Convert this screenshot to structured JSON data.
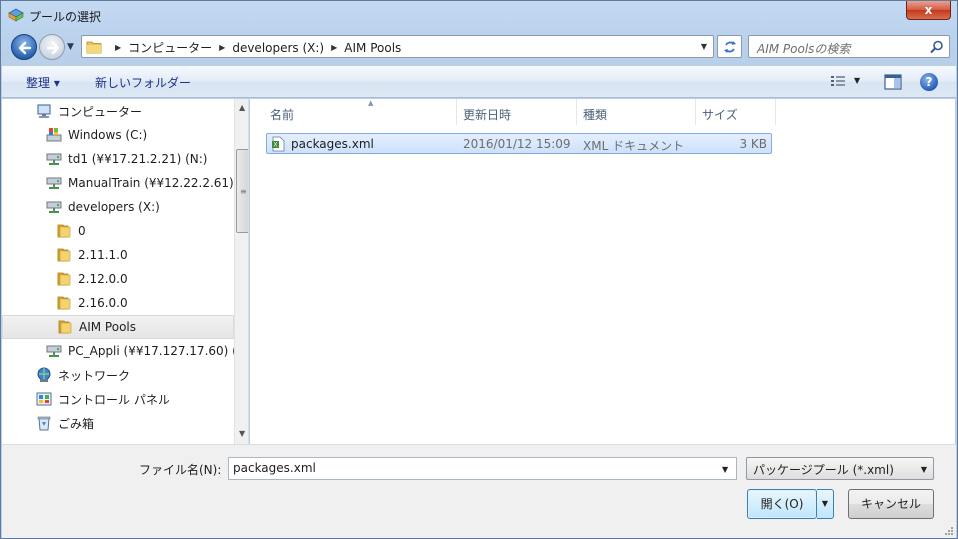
{
  "window": {
    "title": "プールの選択",
    "close_label": "x"
  },
  "address": {
    "crumbs": [
      "コンピューター",
      "developers (X:)",
      "AIM Pools"
    ]
  },
  "search": {
    "placeholder": "AIM Poolsの検索"
  },
  "toolbar": {
    "organize": "整理 ▾",
    "new_folder": "新しいフォルダー",
    "help": "?"
  },
  "nav": {
    "items": [
      {
        "label": "コンピューター",
        "icon": "computer-icon",
        "indent": 0
      },
      {
        "label": "Windows (C:)",
        "icon": "drive-icon",
        "indent": 1
      },
      {
        "label": "td1 (¥¥17.21.2.21) (N:)",
        "icon": "network-drive-icon",
        "indent": 1
      },
      {
        "label": "ManualTrain (¥¥12.22.2.61)",
        "icon": "network-drive-icon",
        "indent": 1
      },
      {
        "label": "developers (X:)",
        "icon": "network-drive-icon",
        "indent": 1
      },
      {
        "label": "0",
        "icon": "folder-icon",
        "indent": 2
      },
      {
        "label": "2.11.1.0",
        "icon": "folder-icon",
        "indent": 2
      },
      {
        "label": "2.12.0.0",
        "icon": "folder-icon",
        "indent": 2
      },
      {
        "label": "2.16.0.0",
        "icon": "folder-icon",
        "indent": 2
      },
      {
        "label": "AIM Pools",
        "icon": "folder-icon",
        "indent": 2,
        "selected": true
      },
      {
        "label": "PC_Appli (¥¥17.127.17.60) (",
        "icon": "network-drive-icon",
        "indent": 1
      },
      {
        "label": "ネットワーク",
        "icon": "network-icon",
        "indent": 0
      },
      {
        "label": "コントロール パネル",
        "icon": "control-panel-icon",
        "indent": 0
      },
      {
        "label": "ごみ箱",
        "icon": "recycle-bin-icon",
        "indent": 0
      }
    ]
  },
  "columns": [
    "名前",
    "更新日時",
    "種類",
    "サイズ"
  ],
  "files": [
    {
      "name": "packages.xml",
      "modified": "2016/01/12 15:09",
      "type": "XML ドキュメント",
      "size": "3 KB"
    }
  ],
  "bottom": {
    "filename_label": "ファイル名(N):",
    "filename_value": "packages.xml",
    "filetype": "パッケージプール (*.xml)",
    "open": "開く(O)",
    "cancel": "キャンセル"
  }
}
